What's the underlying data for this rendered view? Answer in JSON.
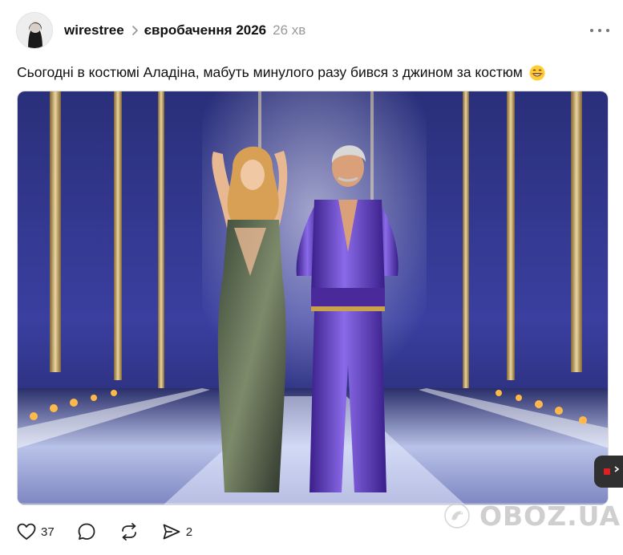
{
  "post": {
    "username": "wirestree",
    "topic": "євробачення 2026",
    "time": "26 хв",
    "text": "Сьогодні в костюмі Аладіна, мабуть минулого разу бився з джином за костюм"
  },
  "actions": {
    "likes": "37",
    "reposts": "2"
  },
  "icons": {
    "avatar": "avatar",
    "chevron": "chevron-right-icon",
    "more": "more-horizontal-icon",
    "emoji": "grinning-face-emoji",
    "like": "heart-icon",
    "comment": "comment-icon",
    "repost": "repost-icon",
    "share": "send-icon"
  },
  "watermark": {
    "text": "OBOZ.UA"
  }
}
